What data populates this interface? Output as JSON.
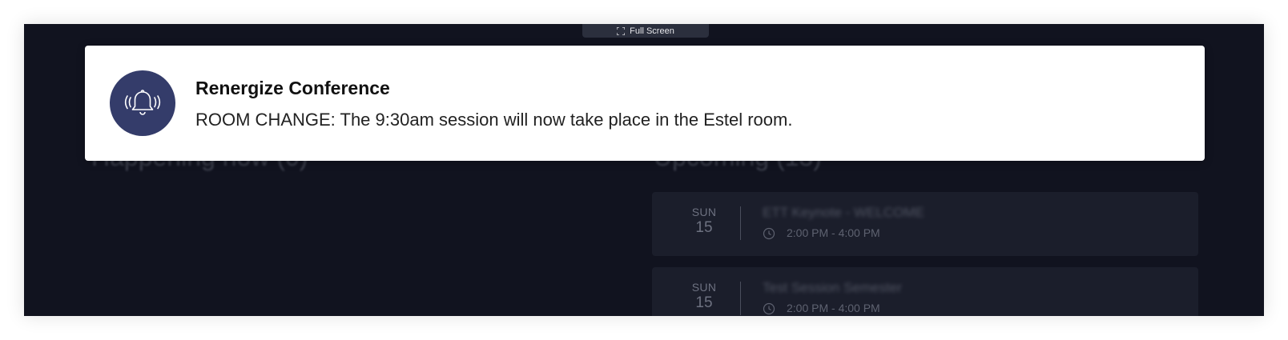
{
  "toolbar": {
    "fullscreen_label": "Full Screen"
  },
  "sections": {
    "happening_now": "Happening now (0)",
    "upcoming": "Upcoming (13)"
  },
  "notification": {
    "title": "Renergize Conference",
    "message": "ROOM CHANGE: The 9:30am session will now take place in the Estel room.",
    "icon": "bell-ringing-icon",
    "icon_bg_color": "#343c6a"
  },
  "sessions": [
    {
      "day": "SUN",
      "date": "15",
      "title": "ETT Keynote - WELCOME",
      "time": "2:00 PM - 4:00 PM"
    },
    {
      "day": "SUN",
      "date": "15",
      "title": "Test Session Semester",
      "time": "2:00 PM - 4:00 PM"
    }
  ],
  "colors": {
    "background": "#11131f",
    "card": "#1b1e2b",
    "accent": "#343c6a"
  }
}
